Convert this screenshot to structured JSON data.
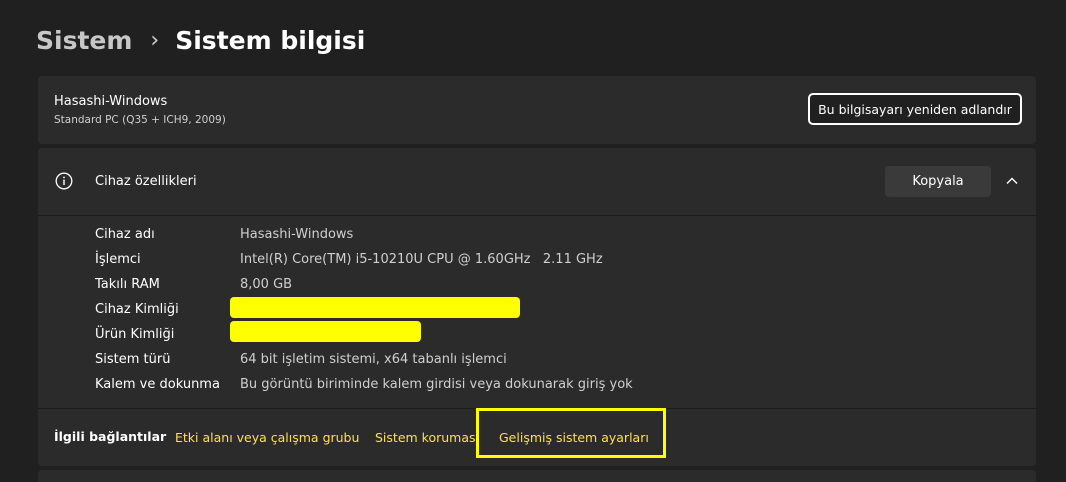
{
  "breadcrumb": {
    "parent": "Sistem",
    "separator": "›",
    "current": "Sistem bilgisi"
  },
  "pc": {
    "name": "Hasashi-Windows",
    "model": "Standard PC (Q35 + ICH9, 2009)",
    "rename_label": "Bu bilgisayarı yeniden adlandır"
  },
  "specs": {
    "icon": "info-icon",
    "title": "Cihaz özellikleri",
    "copy_label": "Kopyala",
    "rows": [
      {
        "label": "Cihaz adı",
        "value": "Hasashi-Windows"
      },
      {
        "label": "İşlemci",
        "value": "Intel(R) Core(TM) i5-10210U CPU @ 1.60GHz   2.11 GHz"
      },
      {
        "label": "Takılı RAM",
        "value": "8,00 GB"
      },
      {
        "label": "Cihaz Kimliği",
        "value": ""
      },
      {
        "label": "Ürün Kimliği",
        "value": ""
      },
      {
        "label": "Sistem türü",
        "value": "64 bit işletim sistemi, x64 tabanlı işlemci"
      },
      {
        "label": "Kalem ve dokunma",
        "value": "Bu görüntü biriminde kalem girdisi veya dokunarak giriş yok"
      }
    ]
  },
  "related": {
    "label": "İlgili bağlantılar",
    "links": [
      "Etki alanı veya çalışma grubu",
      "Sistem koruması",
      "Gelişmiş sistem ayarları"
    ]
  },
  "colors": {
    "background": "#202020",
    "card": "#2b2b2b",
    "link": "#fde04b",
    "highlight": "#ffff00"
  }
}
